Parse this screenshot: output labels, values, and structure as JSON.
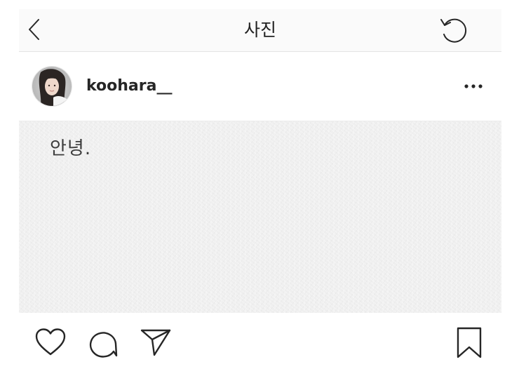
{
  "header": {
    "title": "사진",
    "back_icon": "chevron-left-icon",
    "refresh_icon": "refresh-icon"
  },
  "post": {
    "username": "koohara__",
    "avatar": "profile-avatar",
    "more_icon": "more-options-icon",
    "caption_text": "안녕."
  },
  "actions": {
    "like_icon": "heart-icon",
    "comment_icon": "comment-icon",
    "share_icon": "send-icon",
    "save_icon": "bookmark-icon"
  },
  "colors": {
    "topbar_bg": "#fafafa",
    "image_bg": "#efefef",
    "icon_stroke": "#262626"
  }
}
